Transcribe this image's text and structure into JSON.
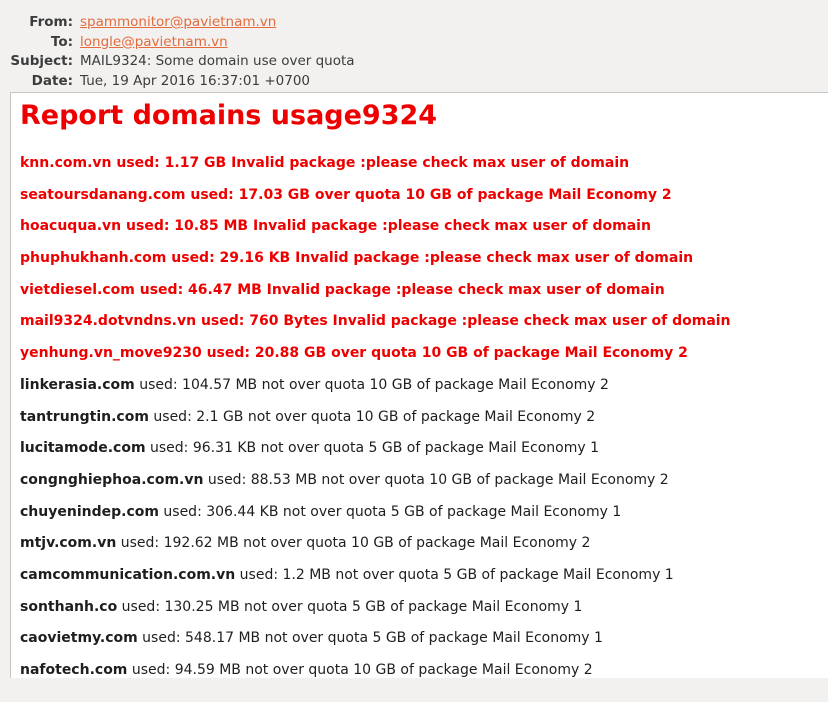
{
  "email": {
    "from_label": "From:",
    "from_value": "spammonitor@pavietnam.vn",
    "to_label": "To:",
    "to_value": "longle@pavietnam.vn",
    "subject_label": "Subject:",
    "subject_value": "MAIL9324: Some domain use over quota",
    "date_label": "Date:",
    "date_value": "Tue, 19 Apr 2016 16:37:01 +0700",
    "link_color": "#e36b3c"
  },
  "report": {
    "title": "Report domains usage9324",
    "alert_color": "#ee0000",
    "over_lines": [
      "knn.com.vn used: 1.17 GB Invalid package :please check max user of domain",
      "seatoursdanang.com used: 17.03 GB over quota 10 GB of package Mail Economy 2",
      "hoacuqua.vn used: 10.85 MB Invalid package :please check max user of domain",
      "phuphukhanh.com used: 29.16 KB Invalid package :please check max user of domain",
      "vietdiesel.com used: 46.47 MB Invalid package :please check max user of domain",
      "mail9324.dotvndns.vn used: 760 Bytes Invalid package :please check max user of domain",
      "yenhung.vn_move9230 used: 20.88 GB over quota 10 GB of package Mail Economy 2"
    ],
    "ok_lines": [
      {
        "domain": "linkerasia.com",
        "detail": " used: 104.57 MB not over quota 10 GB of package Mail Economy 2"
      },
      {
        "domain": "tantrungtin.com",
        "detail": " used: 2.1 GB not over quota 10 GB of package Mail Economy 2"
      },
      {
        "domain": "lucitamode.com",
        "detail": " used: 96.31 KB not over quota 5 GB of package Mail Economy 1"
      },
      {
        "domain": "congnghiephoa.com.vn",
        "detail": " used: 88.53 MB not over quota 10 GB of package Mail Economy 2"
      },
      {
        "domain": "chuyenindep.com",
        "detail": " used: 306.44 KB not over quota 5 GB of package Mail Economy 1"
      },
      {
        "domain": "mtjv.com.vn",
        "detail": " used: 192.62 MB not over quota 10 GB of package Mail Economy 2"
      },
      {
        "domain": "camcommunication.com.vn",
        "detail": " used: 1.2 MB not over quota 5 GB of package Mail Economy 1"
      },
      {
        "domain": "sonthanh.co",
        "detail": " used: 130.25 MB not over quota 5 GB of package Mail Economy 1"
      },
      {
        "domain": "caovietmy.com",
        "detail": " used: 548.17 MB not over quota 5 GB of package Mail Economy 1"
      },
      {
        "domain": "nafotech.com",
        "detail": " used: 94.59 MB not over quota 10 GB of package Mail Economy 2"
      }
    ]
  }
}
